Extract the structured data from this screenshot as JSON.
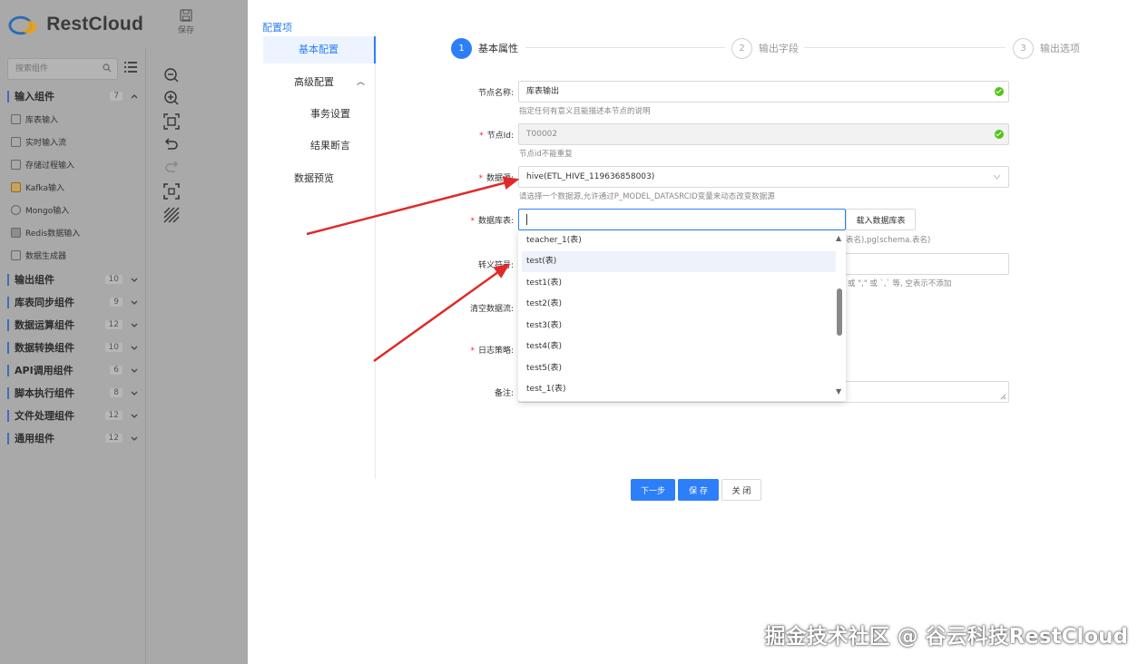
{
  "app": {
    "brand": "RestCloud",
    "save_label": "保存"
  },
  "sidebar": {
    "search_placeholder": "搜索组件",
    "categories": [
      {
        "label": "输入组件",
        "count": "7"
      },
      {
        "label": "输出组件",
        "count": "10"
      },
      {
        "label": "库表同步组件",
        "count": "9"
      },
      {
        "label": "数据运算组件",
        "count": "12"
      },
      {
        "label": "数据转换组件",
        "count": "10"
      },
      {
        "label": "API调用组件",
        "count": "6"
      },
      {
        "label": "脚本执行组件",
        "count": "8"
      },
      {
        "label": "文件处理组件",
        "count": "12"
      },
      {
        "label": "通用组件",
        "count": "12"
      }
    ],
    "input_items": [
      "库表输入",
      "实时输入流",
      "存储过程输入",
      "Kafka输入",
      "Mongo输入",
      "Redis数据输入",
      "数据生成器"
    ]
  },
  "config_nav": {
    "title": "配置项",
    "items": [
      "基本配置",
      "高级配置",
      "事务设置",
      "结果断言",
      "数据预览"
    ]
  },
  "steps": [
    {
      "num": "1",
      "label": "基本属性"
    },
    {
      "num": "2",
      "label": "输出字段"
    },
    {
      "num": "3",
      "label": "输出选项"
    }
  ],
  "form": {
    "node_name": {
      "label": "节点名称:",
      "value": "库表输出",
      "hint": "指定任何有意义且能描述本节点的说明"
    },
    "node_id": {
      "label": "节点Id:",
      "value": "T00002",
      "hint": "节点id不能重复"
    },
    "datasource": {
      "label": "数据源:",
      "value": "hive(ETL_HIVE_119636858003)",
      "hint": "请选择一个数据源,允许通过P_MODEL_DATASRCID变量来动态改变数据源"
    },
    "db_table": {
      "label": "数据库表:",
      "value": "",
      "load_button": "载入数据库表",
      "hint_tail": "表名),pg(schema.表名)"
    },
    "escape": {
      "label": "转义符号:",
      "hint_tail": "或 \",\" 或 `,` 等, 空表示不添加"
    },
    "clear_flow": {
      "label": "清空数据流:"
    },
    "log_policy": {
      "label": "日志策略:"
    },
    "remark": {
      "label": "备注:"
    }
  },
  "dropdown_options": [
    "teacher_1(表)",
    "test(表)",
    "test1(表)",
    "test2(表)",
    "test3(表)",
    "test4(表)",
    "test5(表)",
    "test_1(表)"
  ],
  "buttons": {
    "next": "下一步",
    "save": "保 存",
    "close": "关 闭"
  },
  "watermark": "掘金技术社区 @ 谷云科技RestCloud",
  "colors": {
    "primary": "#2d7ff9",
    "success": "#52c41a",
    "required": "#f5222d",
    "arrow": "#e02a2a"
  }
}
